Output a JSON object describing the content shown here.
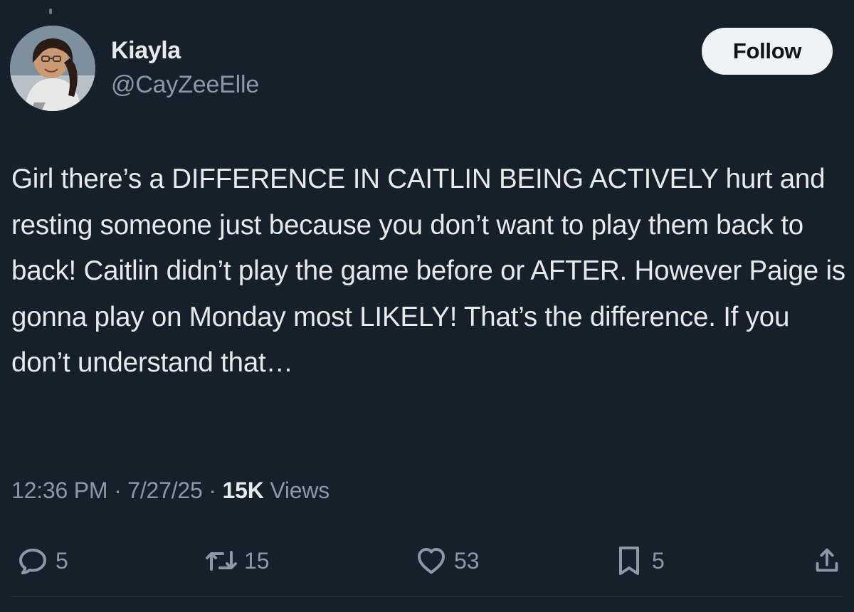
{
  "author": {
    "name": "Kiayla",
    "handle": "@CayZeeElle"
  },
  "follow_label": "Follow",
  "tweet": {
    "text": "Girl there’s a DIFFERENCE IN CAITLIN BEING ACTIVELY hurt and resting someone just because you don’t want to play them back to back! Caitlin didn’t play the game before or AFTER. However Paige is gonna play on Monday most LIKELY! That’s the difference. If you don’t understand that…",
    "time": "12:36 PM",
    "sep1": "·",
    "date": "7/27/25",
    "sep2": "·",
    "views_count": "15K",
    "views_label": "Views"
  },
  "actions": {
    "reply_count": "5",
    "retweet_count": "15",
    "like_count": "53",
    "bookmark_count": "5"
  },
  "icons": {
    "reply": "reply-icon",
    "retweet": "retweet-icon",
    "like": "heart-icon",
    "bookmark": "bookmark-icon",
    "share": "share-icon"
  },
  "colors": {
    "background": "#16202b",
    "text": "#e7e9ea",
    "muted": "#8b98a5",
    "button": "#eff3f4"
  }
}
